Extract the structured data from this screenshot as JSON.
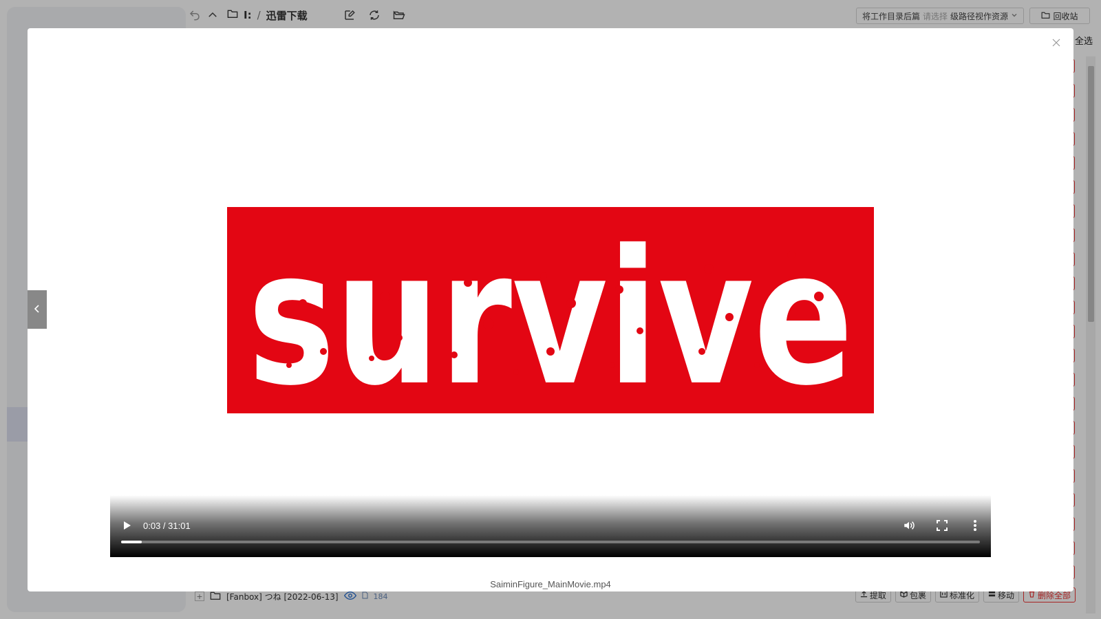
{
  "background_app": {
    "path_drive": "I:",
    "path_sep": "/",
    "path_folder": "迅雷下载",
    "cwd_prefix": "将工作目录后篇",
    "cwd_placeholder": "请选择",
    "cwd_suffix": "级路径视作资源",
    "recycle_label": "回收站",
    "select_all": "全选",
    "file_row": {
      "expand": "+",
      "name": "[Fanbox] つね [2022-06-13]",
      "count": "184"
    },
    "row_actions": [
      {
        "label": "提取",
        "icon": "upload-icon"
      },
      {
        "label": "包裹",
        "icon": "package-icon"
      },
      {
        "label": "标准化",
        "icon": "standardize-icon"
      },
      {
        "label": "移动",
        "icon": "move-icon"
      },
      {
        "label": "删除全部",
        "icon": "delete-icon"
      }
    ]
  },
  "viewer": {
    "close_icon": "close-icon",
    "prev_icon": "chevron-left-icon",
    "video": {
      "frame_text": "survive",
      "frame_bg": "#e30613",
      "time": "0:03 / 31:01",
      "progress": 0.0016,
      "controls": [
        "play-icon",
        "volume-icon",
        "fullscreen-icon",
        "more-icon"
      ]
    },
    "filename": "SaiminFigure_MainMovie.mp4"
  }
}
